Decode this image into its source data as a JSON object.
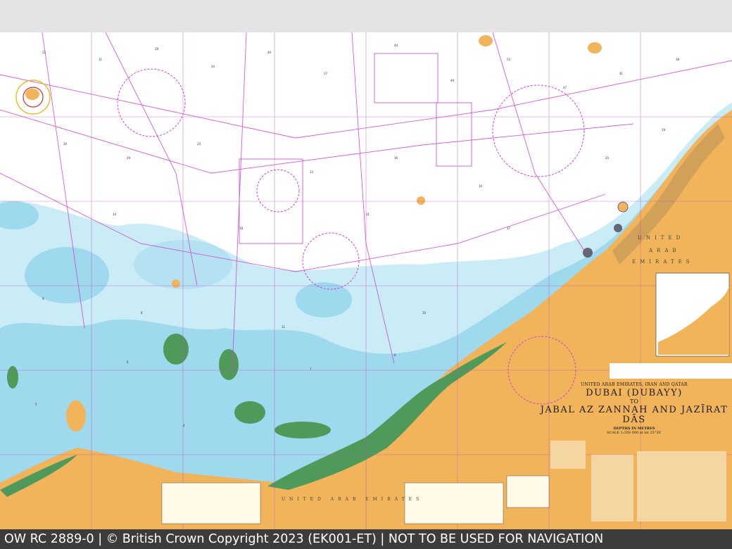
{
  "chart": {
    "title_region": "UNITED ARAB EMIRATES, IRAN AND QATAR",
    "title_main_1": "DUBAI (DUBAYY)",
    "title_to": "TO",
    "title_main_2": "JABAL AZ ZANNAH AND JAZĪRAT DĀS",
    "depths_note": "DEPTHS IN METRES",
    "scale_note": "SCALE 1:350 000 at lat 25°30′",
    "country_label_1": "UNITED",
    "country_label_2": "ARAB",
    "country_label_3": "EMIRATES",
    "country_label_bottom": "UNITED ARAB EMIRATES"
  },
  "footer": {
    "text": "OW RC 2889-0 | © British Crown Copyright 2023 (EK001-ET) | NOT TO BE USED FOR NAVIGATION"
  },
  "colors": {
    "land": "#f2b45a",
    "vegetation": "#4f9a5a",
    "shallow": "#9ed8ec",
    "mid": "#c8ecf6",
    "deep": "#ffffff",
    "magenta": "#d040d8"
  }
}
